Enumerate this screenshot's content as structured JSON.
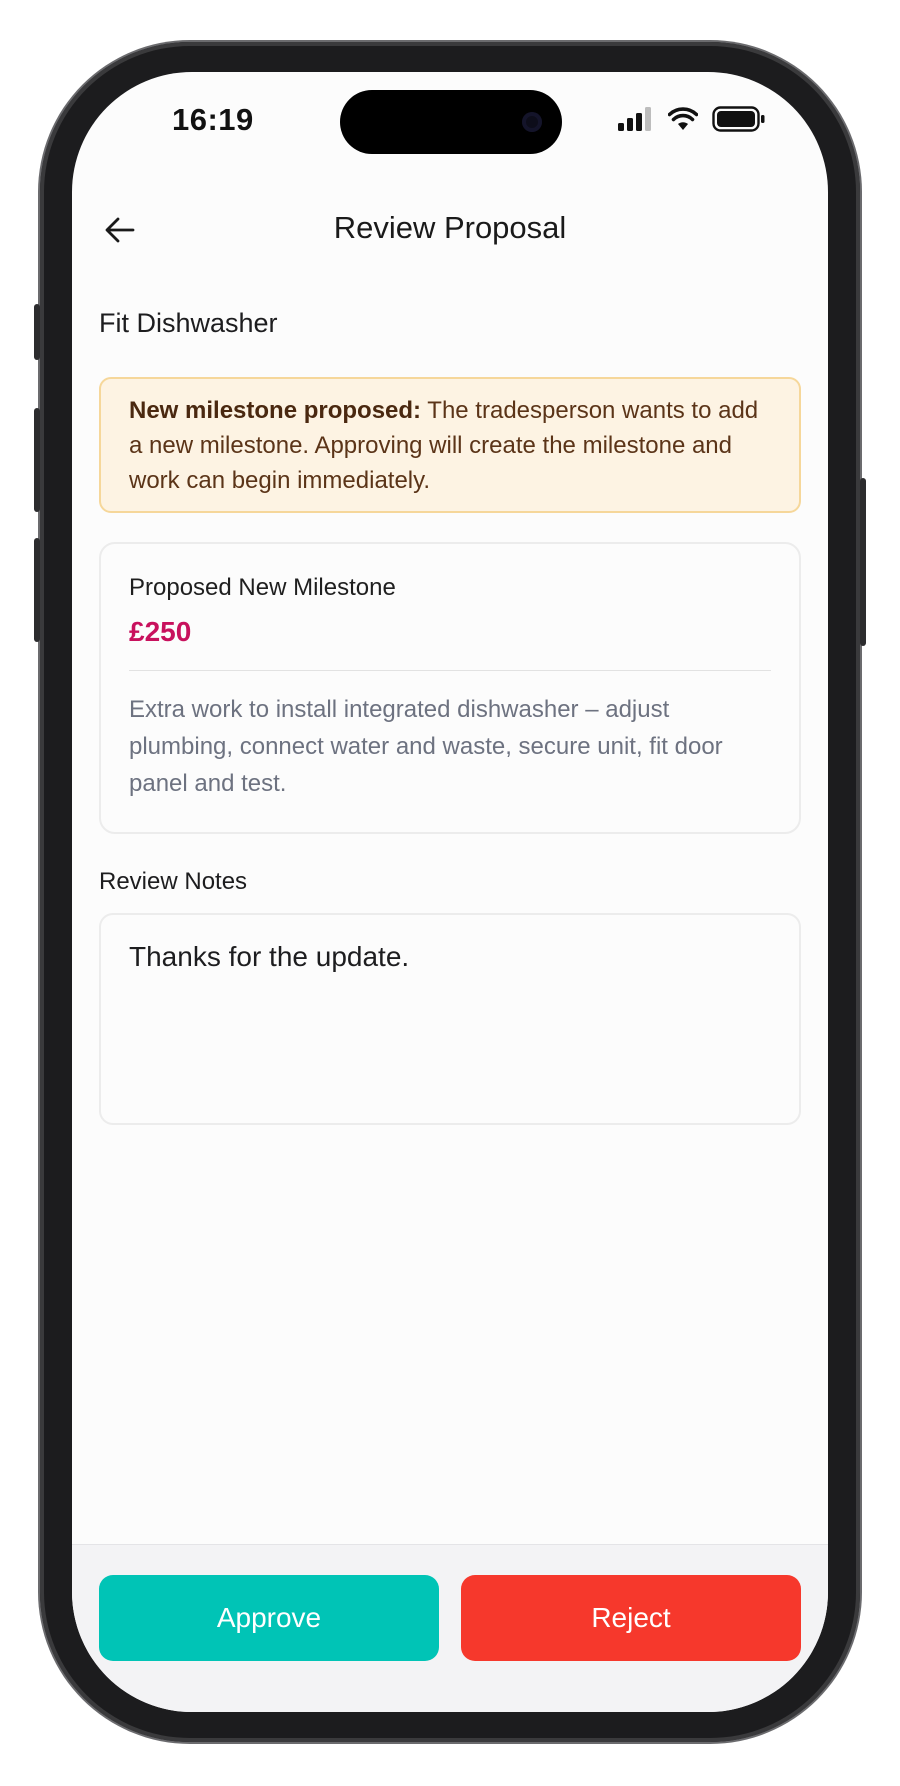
{
  "status_bar": {
    "time": "16:19",
    "icons": [
      "cellular-signal-icon",
      "wifi-icon",
      "battery-icon"
    ]
  },
  "header": {
    "title": "Review Proposal",
    "back_icon": "arrow-left-icon"
  },
  "job": {
    "title": "Fit Dishwasher"
  },
  "notice": {
    "heading": "New milestone proposed:",
    "text": " The tradesperson wants to add a new milestone. Approving will create the milestone and work can begin immediately."
  },
  "milestone": {
    "label": "Proposed New Milestone",
    "amount": "£250",
    "description": "Extra work to install integrated dishwasher – adjust plumbing, connect water and waste, secure unit, fit door panel and test."
  },
  "review_notes": {
    "label": "Review Notes",
    "value": "Thanks for the update."
  },
  "actions": {
    "approve_label": "Approve",
    "reject_label": "Reject"
  },
  "colors": {
    "accent_teal": "#00c4b6",
    "danger_red": "#f6382c",
    "amount_pink": "#c8115d",
    "notice_bg": "#fdf3e3",
    "notice_border": "#f6d79a"
  }
}
